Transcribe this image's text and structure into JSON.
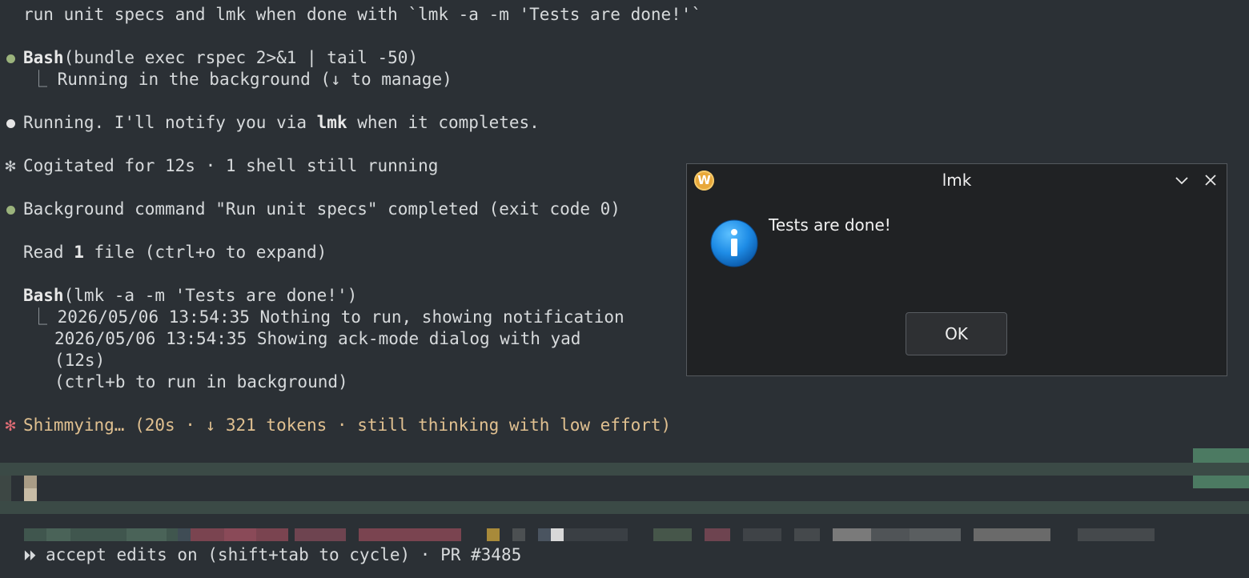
{
  "terminal": {
    "prompt_line": "run unit specs and lmk when done with `lmk -a -m 'Tests are done!'`",
    "bash1": {
      "tool": "Bash",
      "args": "(bundle exec rspec 2>&1 | tail -50)",
      "result": "Running in the background (↓ to manage)"
    },
    "running_prefix": "Running. I'll notify you via ",
    "running_cmd": "lmk",
    "running_suffix": " when it completes.",
    "cogitated": "Cogitated for 12s · 1 shell still running",
    "background_done": "Background command \"Run unit specs\" completed (exit code 0)",
    "read_prefix": "Read ",
    "read_count": "1",
    "read_suffix": " file (ctrl+o to expand)",
    "bash2": {
      "tool": "Bash",
      "args": "(lmk -a -m 'Tests are done!')",
      "out1": "2026/05/06 13:54:35 Nothing to run, showing notification",
      "out2": "2026/05/06 13:54:35 Showing ack-mode dialog with yad",
      "out3": "(12s)",
      "out4": "(ctrl+b to run in background)"
    },
    "shimmying": "Shimmying… (20s · ↓ 321 tokens · still thinking with low effort)",
    "status_line": "accept edits on (shift+tab to cycle) · PR #3485",
    "status_glyph": "⏵⏵"
  },
  "dialog": {
    "title": "lmk",
    "app_icon_letter": "W",
    "message": "Tests are done!",
    "ok_label": "OK"
  },
  "colors": {
    "background": "#2b3035",
    "dot_green": "#9bb37c",
    "star_pink": "#e06c75",
    "dialog_bg": "#202224",
    "info_blue": "#1e8ce6"
  }
}
